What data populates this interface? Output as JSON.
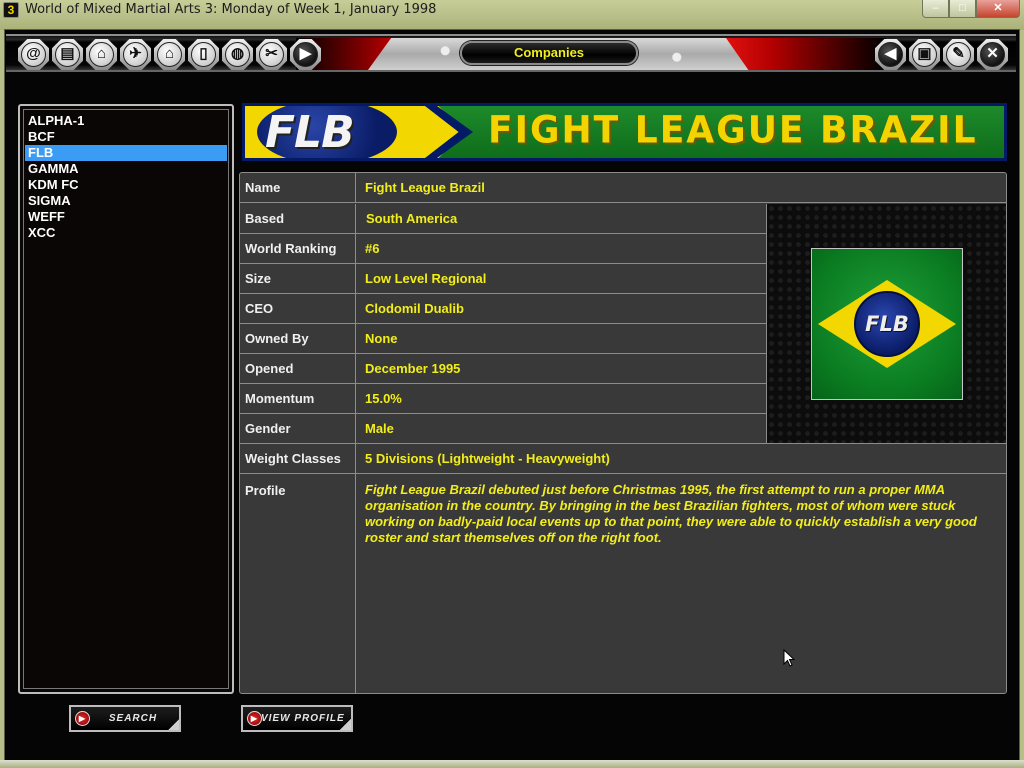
{
  "window": {
    "title": "World of Mixed Martial Arts 3: Monday of Week 1, January 1998",
    "app_icon_glyph": "3",
    "controls": {
      "minimize": "–",
      "maximize": "□",
      "close": "✕"
    }
  },
  "toolbar": {
    "screen_title": "Companies",
    "left_icons": [
      {
        "name": "email-icon",
        "glyph": "@"
      },
      {
        "name": "filing-cabinet-icon",
        "glyph": "▤"
      },
      {
        "name": "home-icon",
        "glyph": "⌂"
      },
      {
        "name": "fighter-kick-icon",
        "glyph": "✈"
      },
      {
        "name": "house-person-icon",
        "glyph": "⌂"
      },
      {
        "name": "media-player-icon",
        "glyph": "▯"
      },
      {
        "name": "globe-icon",
        "glyph": "◍"
      },
      {
        "name": "tools-icon",
        "glyph": "✂"
      },
      {
        "name": "play-continue-icon",
        "glyph": "▶"
      }
    ],
    "right_icons": [
      {
        "name": "back-icon",
        "glyph": "◀"
      },
      {
        "name": "save-disk-icon",
        "glyph": "▣"
      },
      {
        "name": "clipboard-edit-icon",
        "glyph": "✎"
      },
      {
        "name": "close-exit-icon",
        "glyph": "✕"
      }
    ]
  },
  "company_list": {
    "items": [
      "ALPHA-1",
      "BCF",
      "FLB",
      "GAMMA",
      "KDM FC",
      "SIGMA",
      "WEFF",
      "XCC"
    ],
    "selected": "FLB"
  },
  "banner": {
    "abbreviation": "FLB",
    "full_name": "FIGHT LEAGUE BRAZIL"
  },
  "details": {
    "rows": [
      {
        "label": "Name",
        "value": "Fight League Brazil"
      },
      {
        "label": "Based",
        "value": "South America"
      },
      {
        "label": "World Ranking",
        "value": "#6"
      },
      {
        "label": "Size",
        "value": "Low Level Regional"
      },
      {
        "label": "CEO",
        "value": "Clodomil Dualib"
      },
      {
        "label": "Owned By",
        "value": "None"
      },
      {
        "label": "Opened",
        "value": "December 1995"
      },
      {
        "label": "Momentum",
        "value": "15.0%"
      },
      {
        "label": "Gender",
        "value": "Male"
      },
      {
        "label": "Weight Classes",
        "value": "5 Divisions (Lightweight - Heavyweight)"
      }
    ],
    "profile_label": "Profile",
    "profile_text": "Fight League Brazil debuted just before Christmas 1995, the first attempt to run a proper MMA organisation in the country. By bringing in the best Brazilian fighters, most of whom were stuck working on badly-paid local events up to that point, they were able to quickly establish a very good roster and start themselves off on the right foot.",
    "logo_abbreviation": "FLB"
  },
  "buttons": {
    "search": "SEARCH",
    "view_profile": "VIEW PROFILE",
    "play_glyph": "▶"
  },
  "colors": {
    "value_text": "#f2ee1a",
    "selected_item": "#3a9cf4",
    "brazil_green": "#0f6d1b",
    "brazil_yellow": "#f2d800",
    "brazil_blue": "#031a66"
  }
}
